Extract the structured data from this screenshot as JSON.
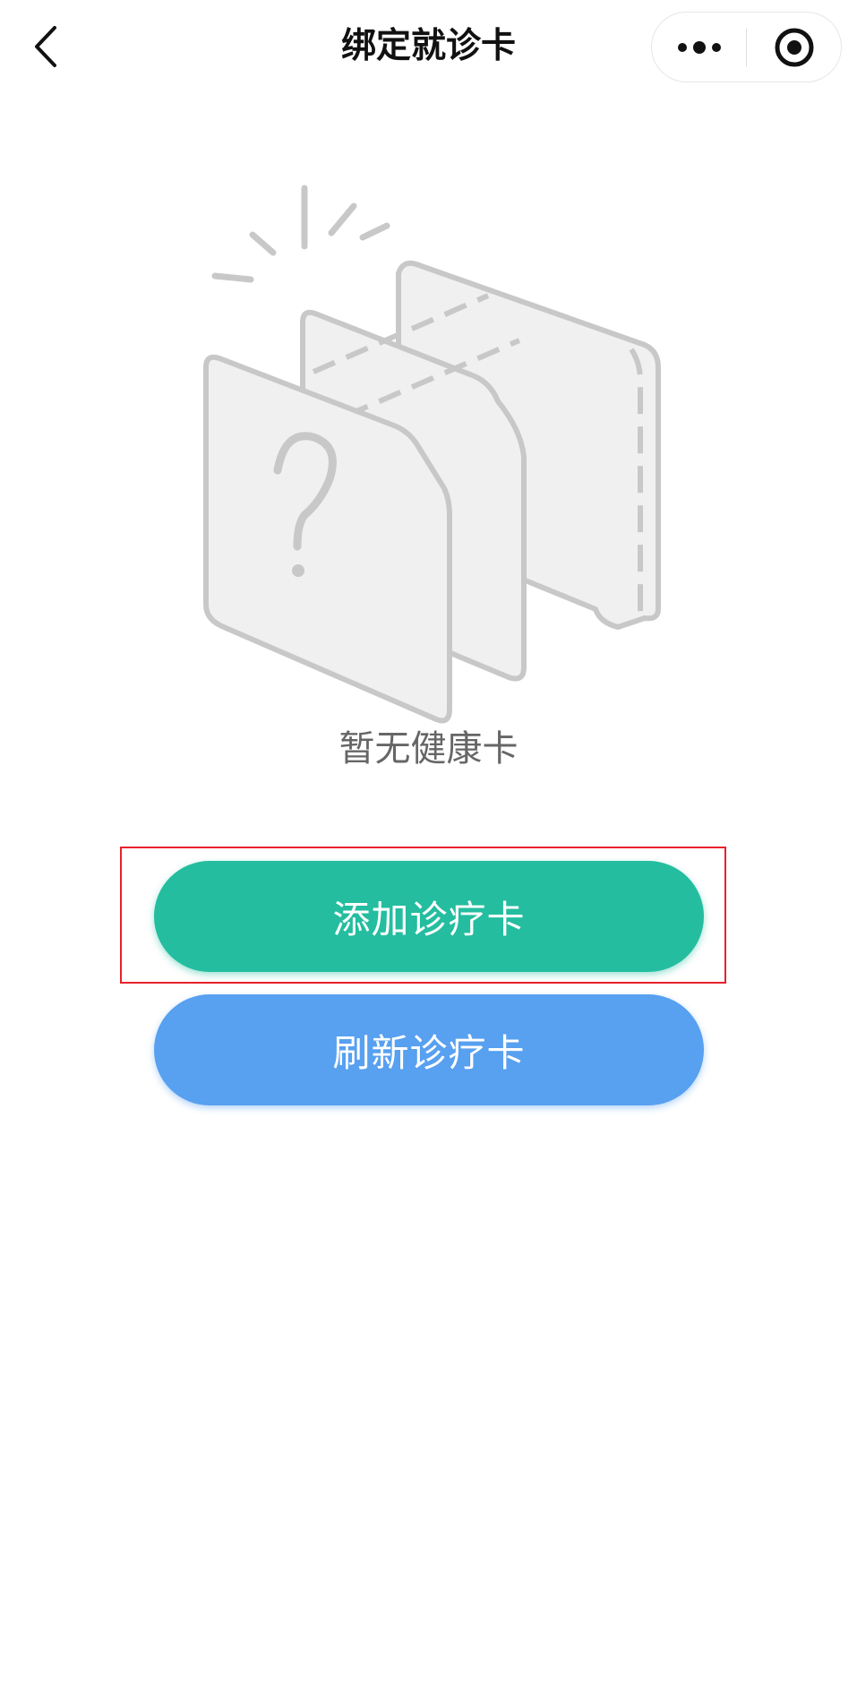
{
  "header": {
    "title": "绑定就诊卡",
    "icons": {
      "back": "chevron-left-icon",
      "more": "more-dots-icon",
      "close": "target-close-icon"
    }
  },
  "empty_state": {
    "message": "暂无健康卡",
    "illustration": "empty-cards-illustration"
  },
  "actions": {
    "add_card_label": "添加诊疗卡",
    "refresh_card_label": "刷新诊疗卡"
  },
  "colors": {
    "add_button": "#24bd9f",
    "refresh_button": "#58a0f0",
    "highlight_border": "#e8212b"
  }
}
